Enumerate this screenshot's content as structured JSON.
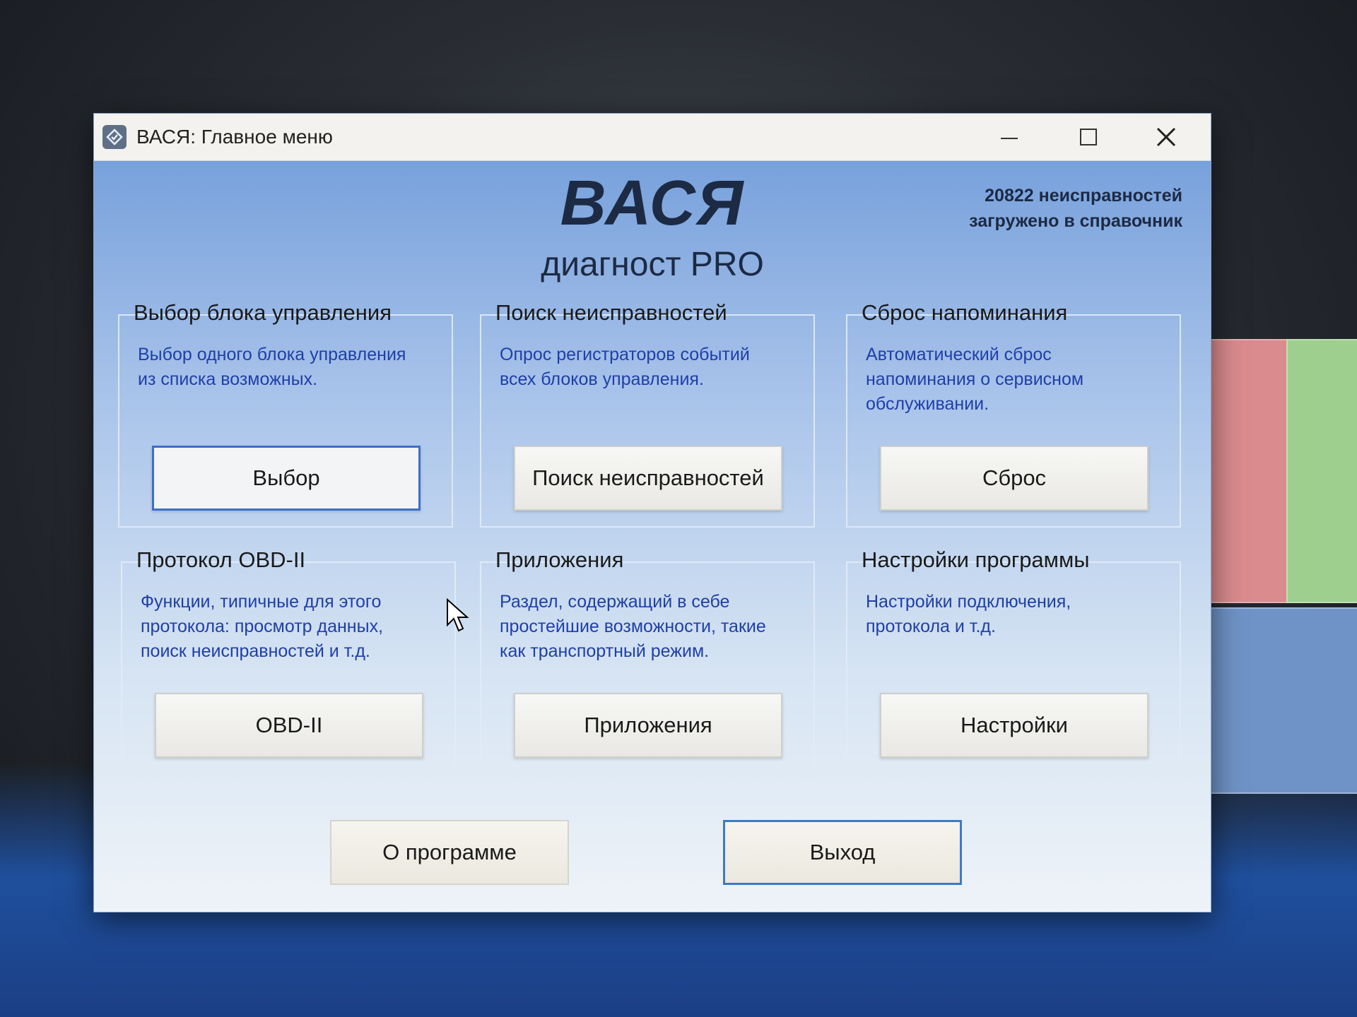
{
  "window": {
    "title": "ВАСЯ:  Главное меню"
  },
  "header": {
    "logo": "ВАСЯ",
    "subtitle": "диагност PRO",
    "faults_line1": "20822 неисправностей",
    "faults_line2": "загружено в справочник"
  },
  "groups": [
    {
      "title": "Выбор блока управления",
      "desc": [
        "Выбор одного блока управления",
        "из списка возможных."
      ],
      "button": "Выбор"
    },
    {
      "title": "Поиск неисправностей",
      "desc": [
        "Опрос регистраторов событий",
        "всех блоков управления."
      ],
      "button": "Поиск неисправностей"
    },
    {
      "title": "Сброс напоминания",
      "desc": [
        "Автоматический сброс",
        "напоминания о сервисном",
        "обслуживании."
      ],
      "button": "Сброс"
    },
    {
      "title": "Протокол OBD-II",
      "desc": [
        "Функции, типичные для этого",
        "протокола: просмотр данных,",
        "поиск неисправностей и т.д."
      ],
      "button": "OBD-II"
    },
    {
      "title": "Приложения",
      "desc": [
        "Раздел, содержащий в себе",
        "простейшие возможности, такие",
        "как транспортный режим."
      ],
      "button": "Приложения"
    },
    {
      "title": "Настройки программы",
      "desc": [
        "Настройки подключения,",
        "протокола и т.д."
      ],
      "button": "Настройки"
    }
  ],
  "footer": {
    "about_label": "О программе",
    "exit_label": "Выход"
  },
  "icons": {
    "app": "app-icon",
    "minimize": "minimize-icon",
    "maximize": "maximize-icon",
    "close": "close-icon",
    "cursor": "mouse-cursor-icon"
  },
  "colors": {
    "accent": "#3d6fc7",
    "desc_text": "#1f3fa8",
    "logo_text": "#1c2a44"
  }
}
